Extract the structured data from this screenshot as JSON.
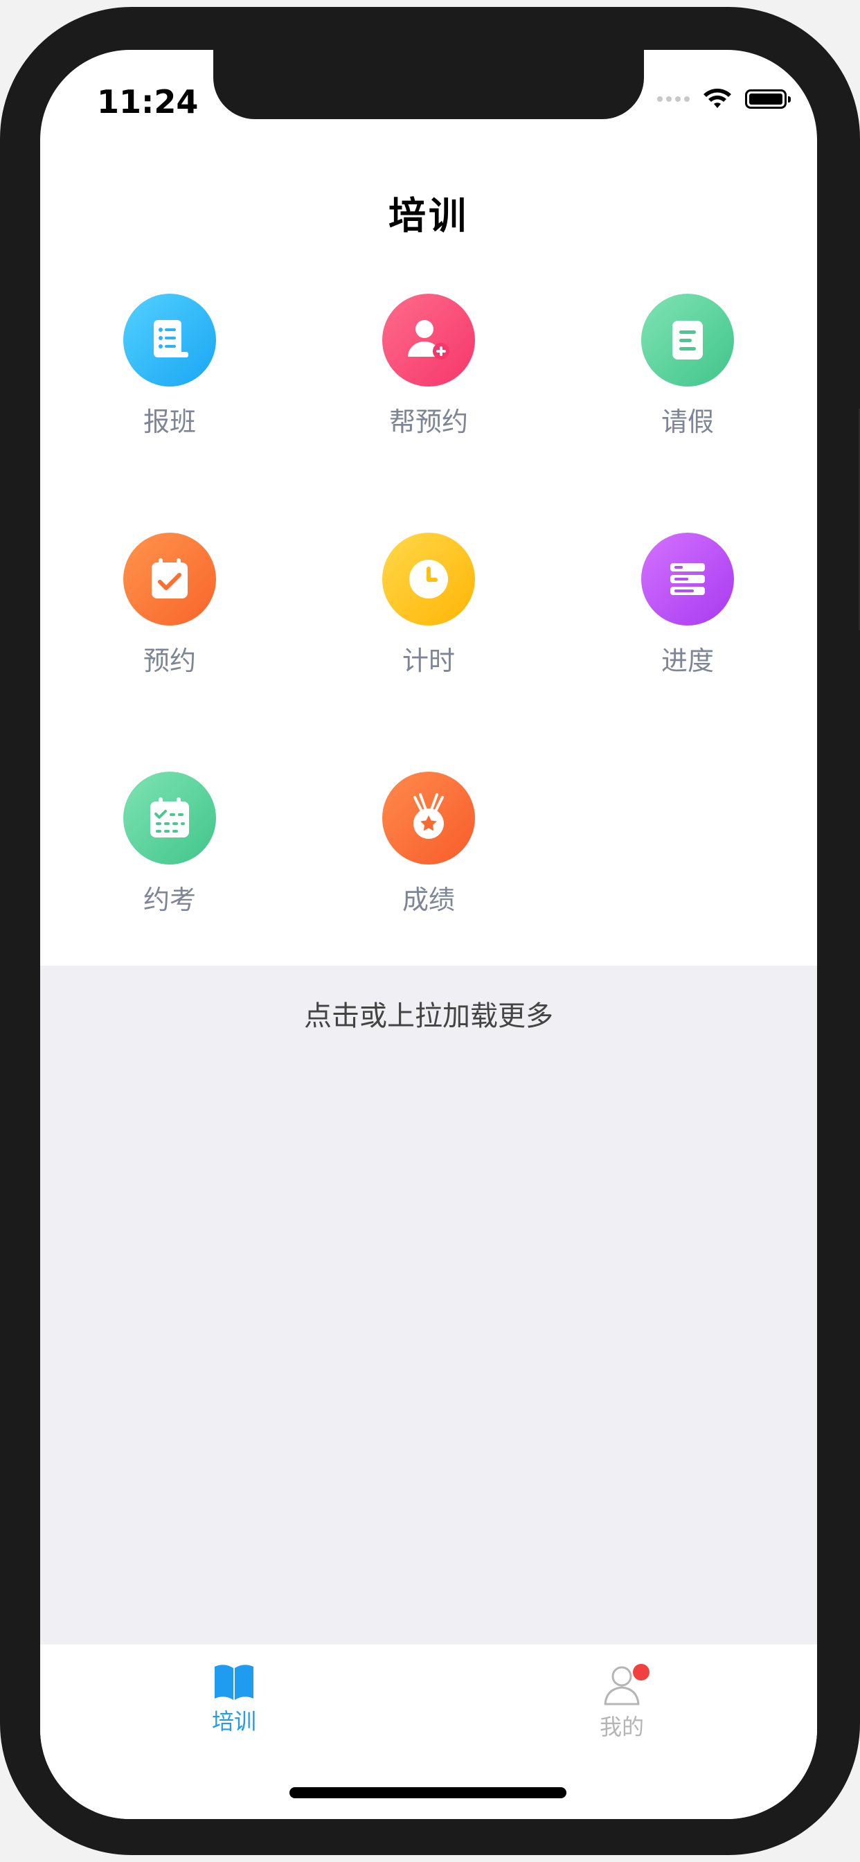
{
  "status_bar": {
    "time": "11:24"
  },
  "nav": {
    "title": "培训"
  },
  "menu": {
    "items": [
      {
        "label": "报班",
        "icon": "form-list-icon",
        "color_from": "#52d1ff",
        "color_to": "#1aa6f3"
      },
      {
        "label": "帮预约",
        "icon": "add-user-icon",
        "color_from": "#ff6b8a",
        "color_to": "#f5376b"
      },
      {
        "label": "请假",
        "icon": "note-icon",
        "color_from": "#7fe3b3",
        "color_to": "#41c58b"
      },
      {
        "label": "预约",
        "icon": "calendar-check-icon",
        "color_from": "#ff944d",
        "color_to": "#f8652a"
      },
      {
        "label": "计时",
        "icon": "clock-icon",
        "color_from": "#ffd84a",
        "color_to": "#ffb505"
      },
      {
        "label": "进度",
        "icon": "progress-bars-icon",
        "color_from": "#d472ff",
        "color_to": "#a83af0"
      },
      {
        "label": "约考",
        "icon": "exam-calendar-icon",
        "color_from": "#7fe3b3",
        "color_to": "#41c58b"
      },
      {
        "label": "成绩",
        "icon": "medal-icon",
        "color_from": "#ff8a4d",
        "color_to": "#f85c2a"
      }
    ]
  },
  "load_more": {
    "text": "点击或上拉加载更多"
  },
  "tabbar": {
    "tabs": [
      {
        "label": "培训",
        "icon": "book-icon",
        "active": true,
        "color": "#1f9bf0"
      },
      {
        "label": "我的",
        "icon": "user-icon",
        "active": false,
        "color": "#b5b5b5",
        "badge": true
      }
    ]
  }
}
